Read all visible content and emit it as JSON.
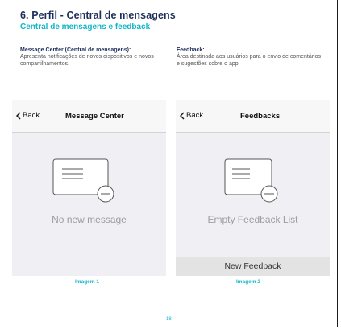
{
  "header": {
    "title": "6. Perfil - Central de mensagens",
    "subtitle": "Central de mensagens e feedback"
  },
  "sections": {
    "left": {
      "heading": "Message Center (Central de mensagens):",
      "body": "Apresenta notificações de novos dispositivos e novos compartilhamentos."
    },
    "right": {
      "heading": "Feedback:",
      "body": "Área destinada aos usuários para o envio de comentários e sugestões sobre o app."
    }
  },
  "screens": {
    "left": {
      "back_label": "Back",
      "nav_title": "Message Center",
      "empty_text": "No new message",
      "icon": "message-card-minus-icon"
    },
    "right": {
      "back_label": "Back",
      "nav_title": "Feedbacks",
      "empty_text": "Empty Feedback List",
      "bottom_button": "New Feedback",
      "icon": "feedback-card-minus-icon"
    }
  },
  "captions": {
    "left": "Imagem 1",
    "right": "Imagem 2"
  },
  "page_number": "18",
  "colors": {
    "title": "#1f2f5c",
    "accent": "#12b6c8",
    "screen_bg": "#efeff4",
    "empty_text": "#9e9e9e"
  }
}
